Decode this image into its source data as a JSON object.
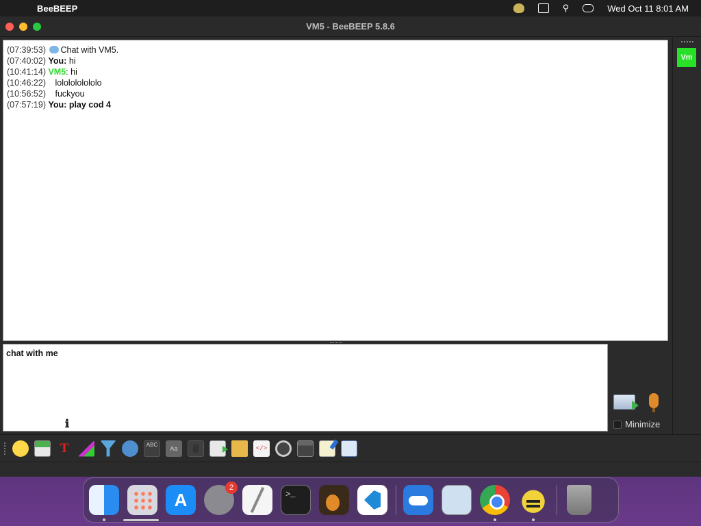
{
  "menubar": {
    "app_name": "BeeBEEP",
    "datetime": "Wed Oct 11  8:01 AM"
  },
  "window": {
    "title": "VM5 - BeeBEEP 5.8.6"
  },
  "chat": {
    "header": {
      "time": "(07:39:53)",
      "text": "Chat with VM5."
    },
    "messages": [
      {
        "time": "(07:40:02)",
        "sender": "You",
        "text": "hi"
      },
      {
        "time": "(10:41:14)",
        "sender": "VM5",
        "text": "hi"
      },
      {
        "time": "(10:46:22)",
        "sender": "",
        "text": "lololololololo"
      },
      {
        "time": "(10:56:52)",
        "sender": "",
        "text": "fuckyou"
      },
      {
        "time": "(07:57:19)",
        "sender": "You",
        "text": "play cod 4"
      }
    ],
    "sender_colors": {
      "VM5": "#2edc2e"
    }
  },
  "input": {
    "value": "chat with me"
  },
  "send_panel": {
    "minimize_label": "Minimize",
    "minimize_checked": false
  },
  "users": [
    {
      "initials": "Vm",
      "color": "#28e028"
    }
  ],
  "toolbar": {
    "buttons": [
      "emoticons-icon",
      "send-mail-icon",
      "font-icon",
      "font-color-icon",
      "filter-icon",
      "settings-icon",
      "spellcheck-icon",
      "dictionary-icon",
      "note-icon",
      "send-file-icon",
      "send-folder-icon",
      "html-icon",
      "screenshot-icon",
      "screen-capture-icon",
      "edit-icon",
      "detach-window-icon"
    ]
  },
  "dock": {
    "apps": [
      "finder",
      "launchpad",
      "app-store",
      "system-settings",
      "textedit",
      "terminal",
      "garageband",
      "vscode",
      "weather",
      "preview",
      "chrome",
      "beebeep",
      "trash"
    ],
    "settings_badge": "2"
  }
}
